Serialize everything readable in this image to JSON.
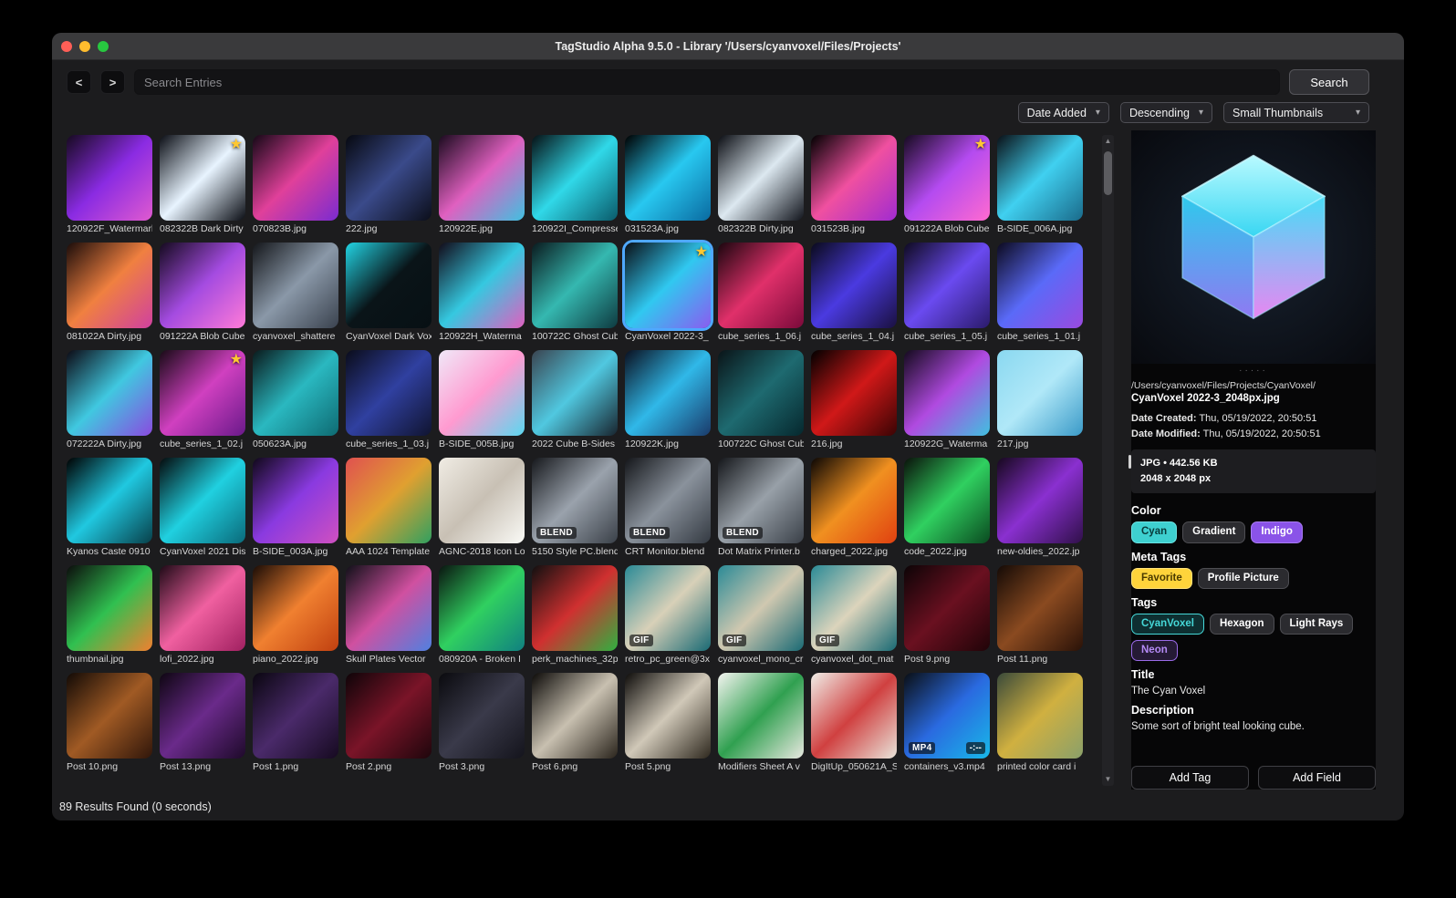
{
  "window": {
    "title": "TagStudio Alpha 9.5.0 - Library '/Users/cyanvoxel/Files/Projects'"
  },
  "toolbar": {
    "back": "<",
    "forward": ">",
    "search_placeholder": "Search Entries",
    "search_button": "Search"
  },
  "filters": {
    "sort_field": "Date Added",
    "sort_order": "Descending",
    "thumb_size": "Small Thumbnails"
  },
  "status": "89 Results Found (0 seconds)",
  "grid": {
    "items": [
      {
        "name": "120922F_Watermark",
        "colors": [
          "#160a20",
          "#8a2be2",
          "#e05ad0"
        ]
      },
      {
        "name": "082322B Dark Dirty",
        "colors": [
          "#0a0d14",
          "#e8f4ff",
          "#0a0d14"
        ],
        "star": true
      },
      {
        "name": "070823B.jpg",
        "colors": [
          "#150816",
          "#e0409a",
          "#7a2bd0"
        ]
      },
      {
        "name": "222.jpg",
        "colors": [
          "#06080f",
          "#3a4a8a",
          "#0b0e1a"
        ]
      },
      {
        "name": "120922E.jpg",
        "colors": [
          "#1a0a1e",
          "#e060c0",
          "#40c0e0"
        ]
      },
      {
        "name": "120922I_Compresse",
        "colors": [
          "#061014",
          "#30d8e8",
          "#0a5a6a"
        ]
      },
      {
        "name": "031523A.jpg",
        "colors": [
          "#000000",
          "#28c8f0",
          "#0a6aa0"
        ]
      },
      {
        "name": "082322B Dirty.jpg",
        "colors": [
          "#0a0c12",
          "#dce8f0",
          "#11141c"
        ]
      },
      {
        "name": "031523B.jpg",
        "colors": [
          "#000000",
          "#f050a0",
          "#a02bd0"
        ]
      },
      {
        "name": "091222A Blob Cube",
        "colors": [
          "#160a20",
          "#b44bf0",
          "#ff6ad0"
        ],
        "star": true
      },
      {
        "name": "B-SIDE_006A.jpg",
        "colors": [
          "#0a1016",
          "#40d0f0",
          "#1a6a8a"
        ]
      },
      {
        "name": "081022A Dirty.jpg",
        "colors": [
          "#1a0c0a",
          "#f08040",
          "#d040a0"
        ]
      },
      {
        "name": "091222A Blob Cube",
        "colors": [
          "#140a1e",
          "#a44be0",
          "#ff7ad8"
        ]
      },
      {
        "name": "cyanvoxel_shattere",
        "colors": [
          "#14161a",
          "#8a98a8",
          "#3a424e"
        ]
      },
      {
        "name": "CyanVoxel Dark Vox",
        "colors": [
          "#22d4e4",
          "#0a1418",
          "#071014"
        ]
      },
      {
        "name": "120922H_Waterma",
        "colors": [
          "#120a18",
          "#35c8e0",
          "#e060c0"
        ]
      },
      {
        "name": "100722C Ghost Cub",
        "colors": [
          "#0a1a1e",
          "#35b8b0",
          "#0e3a40"
        ]
      },
      {
        "name": "CyanVoxel 2022-3_",
        "colors": [
          "#0a0e16",
          "#30c8f0",
          "#8a5cf0"
        ],
        "star": true,
        "selected": true
      },
      {
        "name": "cube_series_1_06.j",
        "colors": [
          "#1a060e",
          "#e0306a",
          "#7a0a3a"
        ]
      },
      {
        "name": "cube_series_1_04.j",
        "colors": [
          "#0a0a1a",
          "#4a3ae0",
          "#1a1040"
        ]
      },
      {
        "name": "cube_series_1_05.j",
        "colors": [
          "#0e0a20",
          "#6a4af0",
          "#2a1a6a"
        ]
      },
      {
        "name": "cube_series_1_01.j",
        "colors": [
          "#0c0a1e",
          "#5a6af8",
          "#9a4ae0"
        ]
      },
      {
        "name": "072222A Dirty.jpg",
        "colors": [
          "#0c0a14",
          "#40c8e0",
          "#8a4ae0"
        ]
      },
      {
        "name": "cube_series_1_02.j",
        "colors": [
          "#180a16",
          "#d040c0",
          "#6a1a8a"
        ],
        "star": true
      },
      {
        "name": "050623A.jpg",
        "colors": [
          "#0a1a1c",
          "#2ab8c0",
          "#0e6a72"
        ]
      },
      {
        "name": "cube_series_1_03.j",
        "colors": [
          "#0a0c1a",
          "#3040a0",
          "#101430"
        ]
      },
      {
        "name": "B-SIDE_005B.jpg",
        "colors": [
          "#f0e8f8",
          "#ff9ad0",
          "#5ad8f0"
        ]
      },
      {
        "name": "2022 Cube B-Sides",
        "colors": [
          "#3a4450",
          "#50c8e0",
          "#18242e"
        ]
      },
      {
        "name": "120922K.jpg",
        "colors": [
          "#0a1020",
          "#30b8e8",
          "#1a3a6a"
        ]
      },
      {
        "name": "100722C Ghost Cub",
        "colors": [
          "#0a1418",
          "#1e6a70",
          "#06282e"
        ]
      },
      {
        "name": "216.jpg",
        "colors": [
          "#000000",
          "#d01818",
          "#3a0404"
        ]
      },
      {
        "name": "120922G_Waterma",
        "colors": [
          "#140a1e",
          "#b04ae0",
          "#40c0e0"
        ]
      },
      {
        "name": "217.jpg",
        "colors": [
          "#8ad8f0",
          "#b0e8f8",
          "#3a9ac8"
        ]
      },
      {
        "name": "Kyanos Caste 0910",
        "colors": [
          "#000000",
          "#20c8e0",
          "#08404a"
        ]
      },
      {
        "name": "CyanVoxel 2021 Dis",
        "colors": [
          "#050a0c",
          "#20d0e0",
          "#0a6a7a"
        ]
      },
      {
        "name": "B-SIDE_003A.jpg",
        "colors": [
          "#10081a",
          "#8a3ae0",
          "#d050c0"
        ]
      },
      {
        "name": "AAA 1024 Template",
        "colors": [
          "#e05050",
          "#e0a030",
          "#30a060"
        ]
      },
      {
        "name": "AGNC-2018 Icon Lo",
        "colors": [
          "#f0ece4",
          "#c8c0b4",
          "#fafaf6"
        ]
      },
      {
        "name": "5150 Style PC.blend",
        "colors": [
          "#16181c",
          "#9aa2ac",
          "#3a4048"
        ],
        "badge": "BLEND"
      },
      {
        "name": "CRT Monitor.blend",
        "colors": [
          "#14161a",
          "#8a929c",
          "#343a42"
        ],
        "badge": "BLEND"
      },
      {
        "name": "Dot Matrix Printer.b",
        "colors": [
          "#14161a",
          "#98a0a8",
          "#3a4048"
        ],
        "badge": "BLEND"
      },
      {
        "name": "charged_2022.jpg",
        "colors": [
          "#0a0604",
          "#f09020",
          "#e04010"
        ]
      },
      {
        "name": "code_2022.jpg",
        "colors": [
          "#0a120a",
          "#30d060",
          "#0a4a20"
        ]
      },
      {
        "name": "new-oldies_2022.jp",
        "colors": [
          "#16081e",
          "#8a30d0",
          "#30104a"
        ]
      },
      {
        "name": "thumbnail.jpg",
        "colors": [
          "#0c0c0c",
          "#30c050",
          "#f08030"
        ]
      },
      {
        "name": "lofi_2022.jpg",
        "colors": [
          "#1e0a16",
          "#f060a0",
          "#a02060"
        ]
      },
      {
        "name": "piano_2022.jpg",
        "colors": [
          "#1a0c06",
          "#f08030",
          "#c04010"
        ]
      },
      {
        "name": "Skull Plates Vector",
        "colors": [
          "#101018",
          "#d050a0",
          "#5080e0"
        ]
      },
      {
        "name": "080920A - Broken I",
        "colors": [
          "#0a1410",
          "#30d060",
          "#108080"
        ]
      },
      {
        "name": "perk_machines_32p",
        "colors": [
          "#101010",
          "#d03030",
          "#30b040"
        ]
      },
      {
        "name": "retro_pc_green@3x",
        "colors": [
          "#2a8a96",
          "#d8d0b8",
          "#1a6a74"
        ],
        "badge": "GIF"
      },
      {
        "name": "cyanvoxel_mono_cr",
        "colors": [
          "#2a8a96",
          "#d0c8b0",
          "#1a6a74"
        ],
        "badge": "GIF"
      },
      {
        "name": "cyanvoxel_dot_mat",
        "colors": [
          "#2a8a96",
          "#dcd4bc",
          "#1a6a74"
        ],
        "badge": "GIF"
      },
      {
        "name": "Post 9.png",
        "colors": [
          "#0c0406",
          "#6a1020",
          "#200408"
        ]
      },
      {
        "name": "Post 11.png",
        "colors": [
          "#140a06",
          "#8a4a20",
          "#2a1208"
        ]
      },
      {
        "name": "Post 10.png",
        "colors": [
          "#120a06",
          "#a05a24",
          "#30160a"
        ]
      },
      {
        "name": "Post 13.png",
        "colors": [
          "#0e0612",
          "#6a2a8a",
          "#1e0a2a"
        ]
      },
      {
        "name": "Post 1.png",
        "colors": [
          "#0a0610",
          "#4a2a6a",
          "#160a20"
        ]
      },
      {
        "name": "Post 2.png",
        "colors": [
          "#0e0408",
          "#7a1428",
          "#1e060c"
        ]
      },
      {
        "name": "Post 3.png",
        "colors": [
          "#0a0a0e",
          "#3a3a4a",
          "#14141c"
        ]
      },
      {
        "name": "Post 6.png",
        "colors": [
          "#0c0a08",
          "#c8c0b0",
          "#2a241c"
        ]
      },
      {
        "name": "Post 5.png",
        "colors": [
          "#0e0c0a",
          "#d0c8b8",
          "#2e281e"
        ]
      },
      {
        "name": "Modifiers Sheet A v",
        "colors": [
          "#f4f4f0",
          "#30a050",
          "#e8e8e0"
        ]
      },
      {
        "name": "DigItUp_050621A_S",
        "colors": [
          "#f0eee8",
          "#d04040",
          "#e8e4da"
        ]
      },
      {
        "name": "containers_v3.mp4",
        "colors": [
          "#0a0e14",
          "#2a6ae0",
          "#18b8e8"
        ],
        "badge": "MP4",
        "duration": "-:--"
      },
      {
        "name": "printed color card i",
        "colors": [
          "#3a4a3a",
          "#d0b040",
          "#8aa06a"
        ]
      }
    ]
  },
  "preview": {
    "drag_dots": "·····",
    "path": "/Users/cyanvoxel/Files/Projects/CyanVoxel/",
    "filename": "CyanVoxel 2022-3_2048px.jpg",
    "date_created_label": "Date Created:",
    "date_created_value": "Thu, 05/19/2022, 20:50:51",
    "date_modified_label": "Date Modified:",
    "date_modified_value": "Thu, 05/19/2022, 20:50:51",
    "file_info": "JPG • 442.56 KB",
    "dimensions": "2048 x 2048 px",
    "sections": {
      "color_label": "Color",
      "meta_label": "Meta Tags",
      "tags_label": "Tags",
      "title_label": "Title",
      "title_value": "The Cyan Voxel",
      "description_label": "Description",
      "description_value": "Some sort of bright teal looking cube."
    },
    "color_tags": [
      {
        "label": "Cyan",
        "bg": "#3ed0d0",
        "fg": "#083a3a",
        "border": "#6ae2e2"
      },
      {
        "label": "Gradient",
        "bg": "#2b2b2f",
        "fg": "#ffffff",
        "border": "#4d4d52"
      },
      {
        "label": "Indigo",
        "bg": "#8a53e8",
        "fg": "#ffffff",
        "border": "#a87cf2"
      }
    ],
    "meta_tags": [
      {
        "label": "Favorite",
        "bg": "#ffd43b",
        "fg": "#4a3b00",
        "border": "#ffe27a"
      },
      {
        "label": "Profile Picture",
        "bg": "#2b2b2f",
        "fg": "#ffffff",
        "border": "#4d4d52"
      }
    ],
    "tags": [
      {
        "label": "CyanVoxel",
        "bg": "#0e2f31",
        "fg": "#45d8d8",
        "border": "#45d8d8"
      },
      {
        "label": "Hexagon",
        "bg": "#2b2b2f",
        "fg": "#ffffff",
        "border": "#4d4d52"
      },
      {
        "label": "Light Rays",
        "bg": "#2b2b2f",
        "fg": "#ffffff",
        "border": "#4d4d52"
      },
      {
        "label": "Neon",
        "bg": "#251a35",
        "fg": "#b48af5",
        "border": "#9a6ae8"
      }
    ],
    "add_tag": "Add Tag",
    "add_field": "Add Field"
  }
}
